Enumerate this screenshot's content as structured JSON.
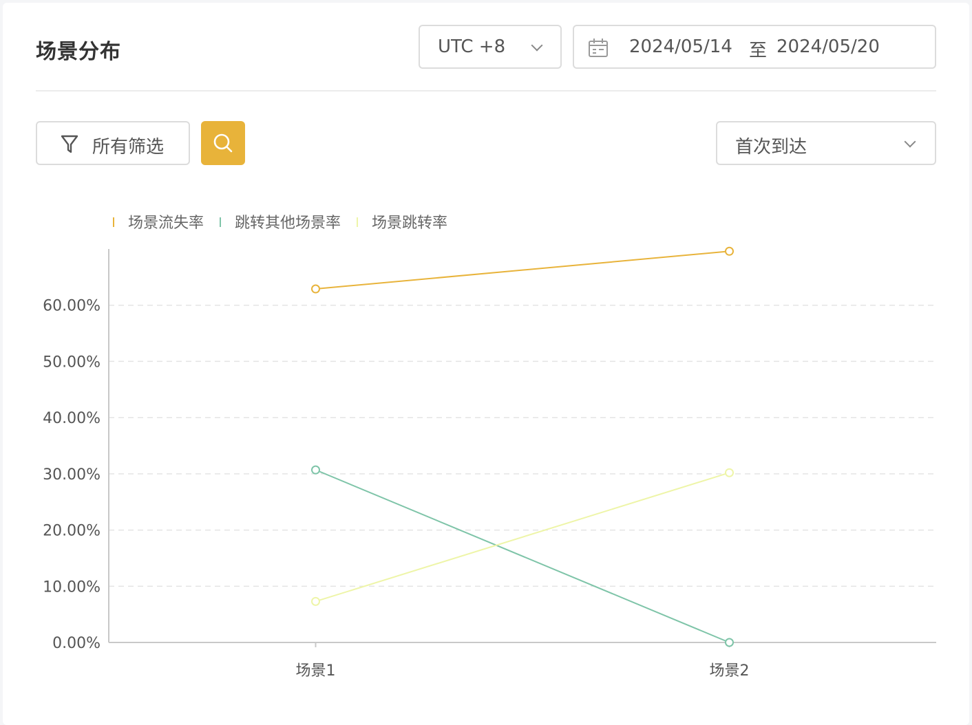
{
  "header": {
    "title": "场景分布",
    "timezone": "UTC +8",
    "date_start": "2024/05/14",
    "date_separator": "至",
    "date_end": "2024/05/20"
  },
  "toolbar": {
    "filter_label": "所有筛选",
    "metric_selected": "首次到达"
  },
  "colors": {
    "accent": "#e8b33a",
    "loss": "#e8b33a",
    "jump_other": "#7ec4a8",
    "jump": "#eef5a8"
  },
  "chart_data": {
    "type": "line",
    "categories": [
      "场景1",
      "场景2"
    ],
    "series": [
      {
        "name": "场景流失率",
        "values": [
          62.9,
          69.6
        ],
        "color": "#e8b33a"
      },
      {
        "name": "跳转其他场景率",
        "values": [
          30.7,
          0.0
        ],
        "color": "#7ec4a8"
      },
      {
        "name": "场景跳转率",
        "values": [
          7.3,
          30.2
        ],
        "color": "#eef5a8"
      }
    ],
    "y_ticks": [
      "0.00%",
      "10.00%",
      "20.00%",
      "30.00%",
      "40.00%",
      "50.00%",
      "60.00%"
    ],
    "ylim": [
      0,
      70
    ],
    "grid": true,
    "legend_position": "top-left",
    "title": "",
    "xlabel": "",
    "ylabel": ""
  }
}
